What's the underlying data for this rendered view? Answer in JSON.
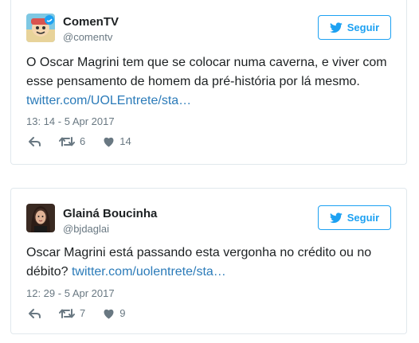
{
  "colors": {
    "accent": "#1da1f2",
    "link": "#2b7bb9",
    "muted": "#697882",
    "border": "#e1e8ed"
  },
  "tweets": [
    {
      "name": "ComenTV",
      "handle": "@comentv",
      "follow_label": "Seguir",
      "text": "O Oscar Magrini tem que se colocar numa caverna, e viver com esse pensamento de homem da pré-história por lá mesmo. ",
      "link": "twitter.com/UOLEntrete/sta…",
      "timestamp": "13: 14 - 5 Apr 2017",
      "retweets": "6",
      "likes": "14",
      "avatar_icon": "comentv-logo-avatar"
    },
    {
      "name": "Glainá Boucinha",
      "handle": "@bjdaglai",
      "follow_label": "Seguir",
      "text": "Oscar Magrini está passando esta vergonha no crédito ou no débito? ",
      "link": "twitter.com/uolentrete/sta…",
      "timestamp": "12: 29 - 5 Apr 2017",
      "retweets": "7",
      "likes": "9",
      "avatar_icon": "user-photo-avatar"
    }
  ]
}
